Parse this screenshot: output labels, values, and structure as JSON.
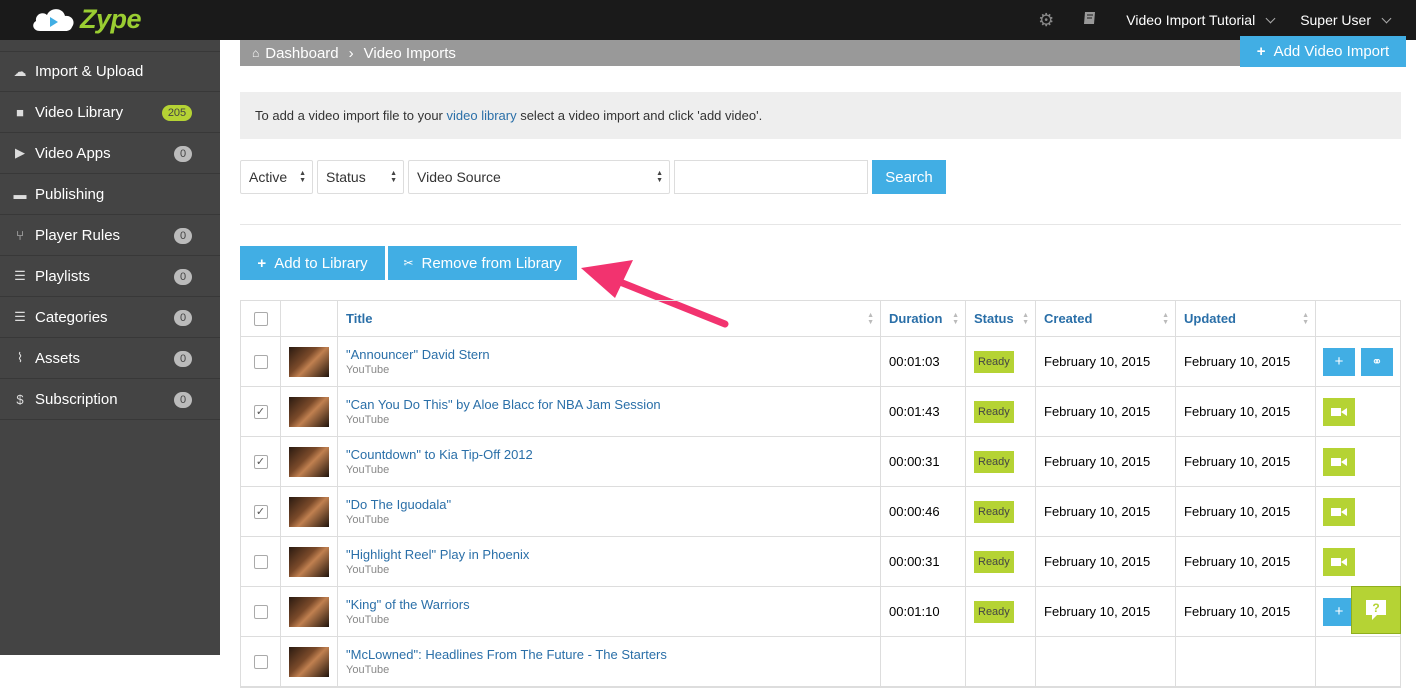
{
  "app": {
    "logo_text": "Zype"
  },
  "topbar": {
    "settings_icon": "gears-icon",
    "docs_icon": "book-icon",
    "site_menu": "Video Import Tutorial",
    "user_menu": "Super User"
  },
  "sidebar": {
    "items": [
      {
        "label": "Import & Upload",
        "icon": "cloud-upload-icon",
        "badge": ""
      },
      {
        "label": "Video Library",
        "icon": "video-camera-icon",
        "badge": "205"
      },
      {
        "label": "Video Apps",
        "icon": "play-square-icon",
        "badge": "0"
      },
      {
        "label": "Publishing",
        "icon": "truck-icon",
        "badge": ""
      },
      {
        "label": "Player Rules",
        "icon": "branch-icon",
        "badge": "0"
      },
      {
        "label": "Playlists",
        "icon": "list-icon",
        "badge": "0"
      },
      {
        "label": "Categories",
        "icon": "list-icon",
        "badge": "0"
      },
      {
        "label": "Assets",
        "icon": "paperclip-icon",
        "badge": "0"
      },
      {
        "label": "Subscription",
        "icon": "dollar-icon",
        "badge": "0"
      }
    ]
  },
  "breadcrumb": {
    "home": "Dashboard",
    "current": "Video Imports"
  },
  "header": {
    "add_import_label": "Add Video Import"
  },
  "info": {
    "before": "To add a video import file to your ",
    "link": "video library",
    "after": " select a video import and click 'add video'."
  },
  "filters": {
    "active": "Active",
    "status": "Status",
    "source": "Video Source",
    "search_value": "",
    "search_button": "Search"
  },
  "actions": {
    "add": "Add to Library",
    "remove": "Remove from Library"
  },
  "table": {
    "columns": {
      "title": "Title",
      "duration": "Duration",
      "status": "Status",
      "created": "Created",
      "updated": "Updated"
    },
    "rows": [
      {
        "checked": false,
        "title": "\"Announcer\" David Stern",
        "source": "YouTube",
        "duration": "00:01:03",
        "status": "Ready",
        "created": "February 10, 2015",
        "updated": "February 10, 2015",
        "actions": "add-link"
      },
      {
        "checked": true,
        "title": "\"Can You Do This\" by Aloe Blacc for NBA Jam Session",
        "source": "YouTube",
        "duration": "00:01:43",
        "status": "Ready",
        "created": "February 10, 2015",
        "updated": "February 10, 2015",
        "actions": "video"
      },
      {
        "checked": true,
        "title": "\"Countdown\" to Kia Tip-Off 2012",
        "source": "YouTube",
        "duration": "00:00:31",
        "status": "Ready",
        "created": "February 10, 2015",
        "updated": "February 10, 2015",
        "actions": "video"
      },
      {
        "checked": true,
        "title": "\"Do The Iguodala\"",
        "source": "YouTube",
        "duration": "00:00:46",
        "status": "Ready",
        "created": "February 10, 2015",
        "updated": "February 10, 2015",
        "actions": "video"
      },
      {
        "checked": false,
        "title": "\"Highlight Reel\" Play in Phoenix",
        "source": "YouTube",
        "duration": "00:00:31",
        "status": "Ready",
        "created": "February 10, 2015",
        "updated": "February 10, 2015",
        "actions": "video"
      },
      {
        "checked": false,
        "title": "\"King\" of the Warriors",
        "source": "YouTube",
        "duration": "00:01:10",
        "status": "Ready",
        "created": "February 10, 2015",
        "updated": "February 10, 2015",
        "actions": "add-link"
      },
      {
        "checked": false,
        "title": "\"McLowned\": Headlines From The Future - The Starters",
        "source": "YouTube",
        "duration": "",
        "status": "",
        "created": "",
        "updated": "",
        "actions": ""
      }
    ]
  },
  "colors": {
    "accent_blue": "#41aee4",
    "accent_green": "#b5d334",
    "annotation_pink": "#f2336f"
  }
}
